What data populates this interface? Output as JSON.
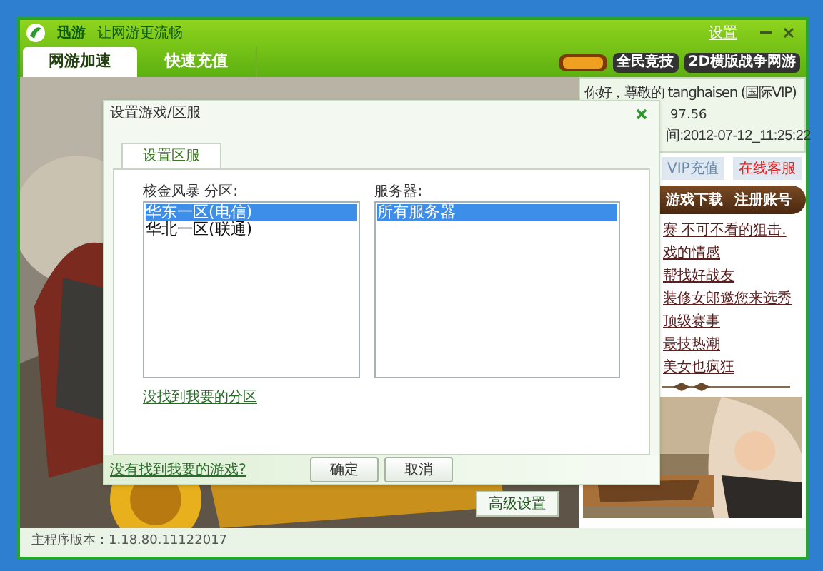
{
  "window": {
    "brand": "迅游",
    "slogan": "让网游更流畅",
    "settings_link": "设置"
  },
  "tabs": [
    {
      "label": "网游加速",
      "selected": true
    },
    {
      "label": "快速充值",
      "selected": false
    }
  ],
  "promo_badges": [
    "全民竞技",
    "2D横版战争网游"
  ],
  "main": {
    "advanced_button": "高级设置"
  },
  "account": {
    "greeting": "你好，尊敬的 tanghaisen (国际VIP)",
    "balance": "97.56",
    "expiry": "间:2012-07-12_11:25:22"
  },
  "account_buttons": [
    {
      "label": "VIP充值",
      "kind": "plain"
    },
    {
      "label": "在线客服",
      "kind": "alert"
    }
  ],
  "actions": [
    "游戏下载",
    "注册账号"
  ],
  "news": [
    "赛 不可不看的狙击.",
    "戏的情感",
    "帮找好战友",
    "装修女郎邀您来选秀",
    "顶级赛事",
    "最技热潮",
    "美女也疯狂"
  ],
  "status_bar": "主程序版本：1.18.80.11122017",
  "dialog": {
    "title": "设置游戏/区服",
    "tabs": [
      {
        "label": "设置区服",
        "selected": true
      }
    ],
    "zone_label": "核金风暴 分区:",
    "server_label": "服务器:",
    "zones": [
      {
        "label": "华东一区(电信)",
        "selected": true
      },
      {
        "label": "华北一区(联通)",
        "selected": false
      }
    ],
    "servers": [
      {
        "label": "所有服务器",
        "selected": true
      }
    ],
    "zone_link": "没找到我要的分区",
    "game_link": "没有找到我要的游戏?",
    "buttons": [
      "确定",
      "取消"
    ]
  }
}
